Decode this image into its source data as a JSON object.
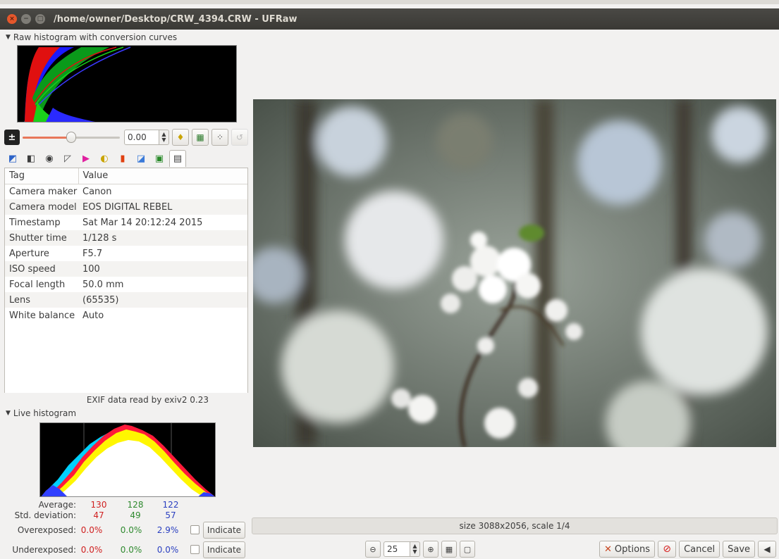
{
  "window": {
    "title": "/home/owner/Desktop/CRW_4394.CRW - UFRaw",
    "close_glyph": "×",
    "minimize_glyph": "−",
    "maximize_glyph": "□"
  },
  "raw_histogram": {
    "header": "Raw histogram with conversion curves"
  },
  "exposure": {
    "value": "0.00",
    "slider_level": 0.5
  },
  "exif": {
    "columns": [
      "Tag",
      "Value"
    ],
    "rows": [
      {
        "tag": "Camera maker",
        "value": "Canon"
      },
      {
        "tag": "Camera model",
        "value": "EOS DIGITAL REBEL"
      },
      {
        "tag": "Timestamp",
        "value": "Sat Mar 14 20:12:24 2015"
      },
      {
        "tag": "Shutter time",
        "value": "1/128 s"
      },
      {
        "tag": "Aperture",
        "value": "F5.7"
      },
      {
        "tag": "ISO speed",
        "value": "100"
      },
      {
        "tag": "Focal length",
        "value": "50.0 mm"
      },
      {
        "tag": "Lens",
        "value": "(65535)"
      },
      {
        "tag": "White balance",
        "value": "Auto"
      }
    ],
    "footer": "EXIF data read by exiv2 0.23"
  },
  "live_histogram": {
    "header": "Live histogram",
    "average_label": "Average:",
    "average": {
      "r": "130",
      "g": "128",
      "b": "122"
    },
    "stddev_label": "Std. deviation:",
    "stddev": {
      "r": "47",
      "g": "49",
      "b": "57"
    },
    "overexposed_label": "Overexposed:",
    "overexposed": {
      "r": "0.0%",
      "g": "0.0%",
      "b": "2.9%"
    },
    "underexposed_label": "Underexposed:",
    "underexposed": {
      "r": "0.0%",
      "g": "0.0%",
      "b": "0.0%"
    },
    "indicate_label": "Indicate"
  },
  "status": {
    "text": "size 3088x2056, scale 1/4"
  },
  "zoom": {
    "value": "25"
  },
  "buttons": {
    "options": "Options",
    "cancel": "Cancel",
    "save": "Save"
  },
  "colors": {
    "titlebar": "#3c3b37",
    "close": "#e5572b",
    "red": "#d02020",
    "green": "#2f8a2f",
    "blue": "#2a3fc0"
  }
}
